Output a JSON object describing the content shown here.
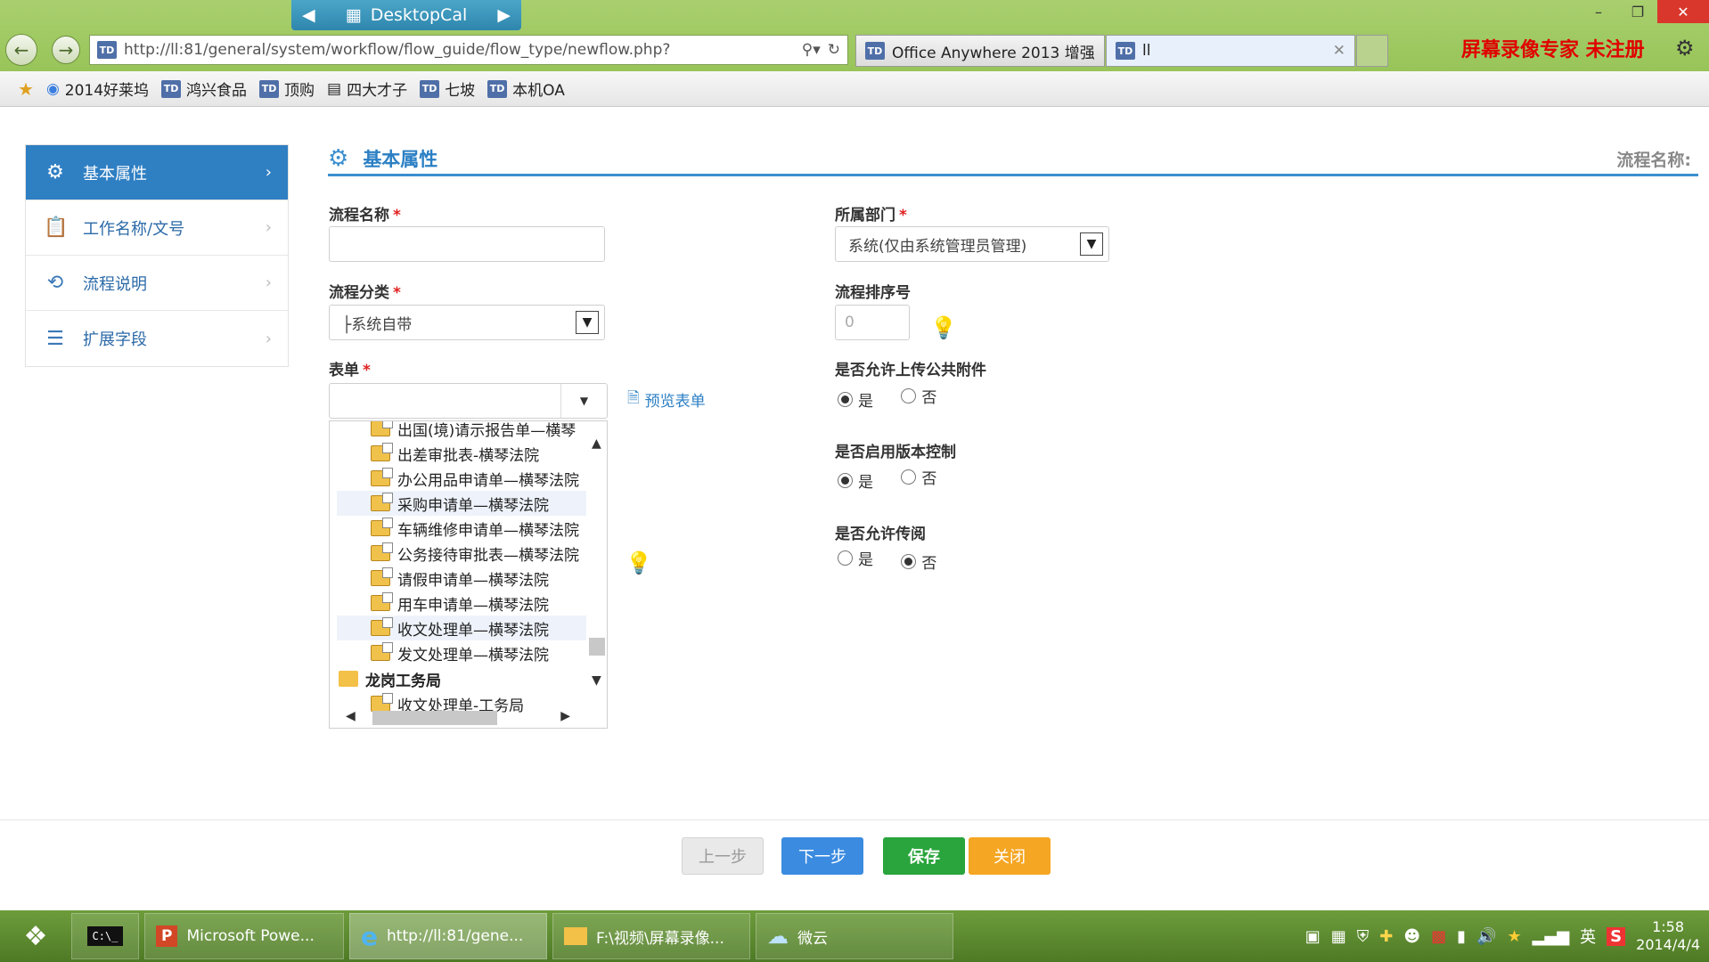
{
  "browser": {
    "desktopcal": "DesktopCal",
    "url": "http://ll:81/general/system/workflow/flow_guide/flow_type/newflow.php?",
    "tabs": [
      {
        "label": "Office Anywhere 2013 增强..."
      },
      {
        "label": "ll"
      }
    ],
    "recorder_text": "屏幕录像专家  未注册",
    "favorites": [
      "2014好莱坞",
      "鸿兴食品",
      "顶购",
      "四大才子",
      "七坡",
      "本机OA"
    ]
  },
  "sidebar": {
    "items": [
      {
        "label": "基本属性",
        "icon": "gear-icon"
      },
      {
        "label": "工作名称/文号",
        "icon": "clipboard-icon"
      },
      {
        "label": "流程说明",
        "icon": "flow-icon"
      },
      {
        "label": "扩展字段",
        "icon": "list-icon"
      }
    ]
  },
  "section": {
    "title": "基本属性",
    "right_label": "流程名称:"
  },
  "form": {
    "flow_name": {
      "label": "流程名称",
      "value": ""
    },
    "department": {
      "label": "所属部门",
      "value": "系统(仅由系统管理员管理)"
    },
    "category": {
      "label": "流程分类",
      "value": "├系统自带"
    },
    "sort_no": {
      "label": "流程排序号",
      "placeholder": "0"
    },
    "form_select": {
      "label": "表单",
      "preview": "预览表单"
    },
    "allow_attach": {
      "label": "是否允许上传公共附件",
      "yes": "是",
      "no": "否",
      "selected": "yes"
    },
    "version_ctrl": {
      "label": "是否启用版本控制",
      "yes": "是",
      "no": "否",
      "selected": "yes"
    },
    "allow_pass": {
      "label": "是否允许传阅",
      "yes": "是",
      "no": "否",
      "selected": "no"
    }
  },
  "tree": {
    "items": [
      {
        "label": "出国(境)请示报告单—横琴",
        "type": "doc"
      },
      {
        "label": "出差审批表-横琴法院",
        "type": "doc"
      },
      {
        "label": "办公用品申请单—横琴法院",
        "type": "doc"
      },
      {
        "label": "采购申请单—横琴法院",
        "type": "doc"
      },
      {
        "label": "车辆维修申请单—横琴法院",
        "type": "doc"
      },
      {
        "label": "公务接待审批表—横琴法院",
        "type": "doc"
      },
      {
        "label": "请假申请单—横琴法院",
        "type": "doc"
      },
      {
        "label": "用车申请单—横琴法院",
        "type": "doc"
      },
      {
        "label": "收文处理单—横琴法院",
        "type": "doc"
      },
      {
        "label": "发文处理单—横琴法院",
        "type": "doc"
      },
      {
        "label": "龙岗工务局",
        "type": "folder"
      },
      {
        "label": "收文处理单-工务局",
        "type": "doc"
      }
    ]
  },
  "buttons": {
    "prev": "上一步",
    "next": "下一步",
    "save": "保存",
    "close": "关闭"
  },
  "taskbar": {
    "tasks": [
      "Microsoft Powe...",
      "http://ll:81/gene...",
      "F:\\视频\\屏幕录像...",
      "微云"
    ],
    "ime": "英",
    "time": "1:58",
    "date": "2014/4/4"
  }
}
